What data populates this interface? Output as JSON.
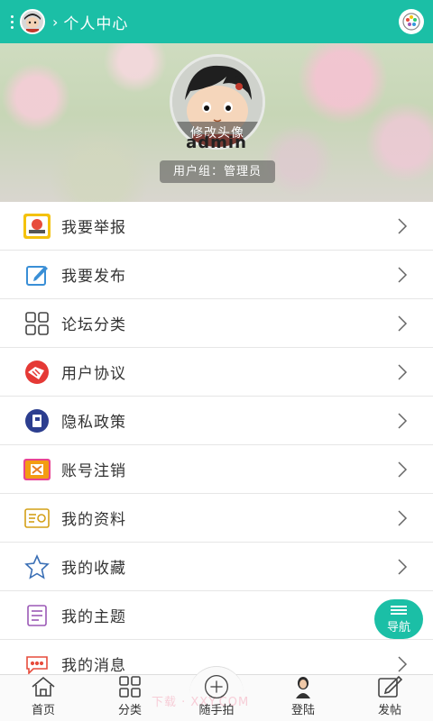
{
  "header": {
    "title": "个人中心",
    "chevron": "›"
  },
  "profile": {
    "avatar_caption": "修改头像",
    "username": "admin",
    "user_group": "用户组：管理员"
  },
  "menu": [
    {
      "label": "我要举报",
      "icon": "report-icon"
    },
    {
      "label": "我要发布",
      "icon": "edit-icon"
    },
    {
      "label": "论坛分类",
      "icon": "grid-icon"
    },
    {
      "label": "用户协议",
      "icon": "agreement-icon"
    },
    {
      "label": "隐私政策",
      "icon": "privacy-icon"
    },
    {
      "label": "账号注销",
      "icon": "cancel-account-icon"
    },
    {
      "label": "我的资料",
      "icon": "profile-card-icon"
    },
    {
      "label": "我的收藏",
      "icon": "star-icon"
    },
    {
      "label": "我的主题",
      "icon": "document-icon"
    },
    {
      "label": "我的消息",
      "icon": "message-icon"
    }
  ],
  "fab": {
    "label": "导航"
  },
  "tabbar": [
    {
      "label": "首页",
      "icon": "home-icon"
    },
    {
      "label": "分类",
      "icon": "grid-icon"
    },
    {
      "label": "随手拍",
      "icon": "plus-circle-icon"
    },
    {
      "label": "登陆",
      "icon": "avatar-icon"
    },
    {
      "label": "发帖",
      "icon": "compose-icon"
    }
  ],
  "watermark": "下载 · XXY.COM",
  "colors": {
    "accent": "#1bbfa6",
    "text": "#333333"
  }
}
